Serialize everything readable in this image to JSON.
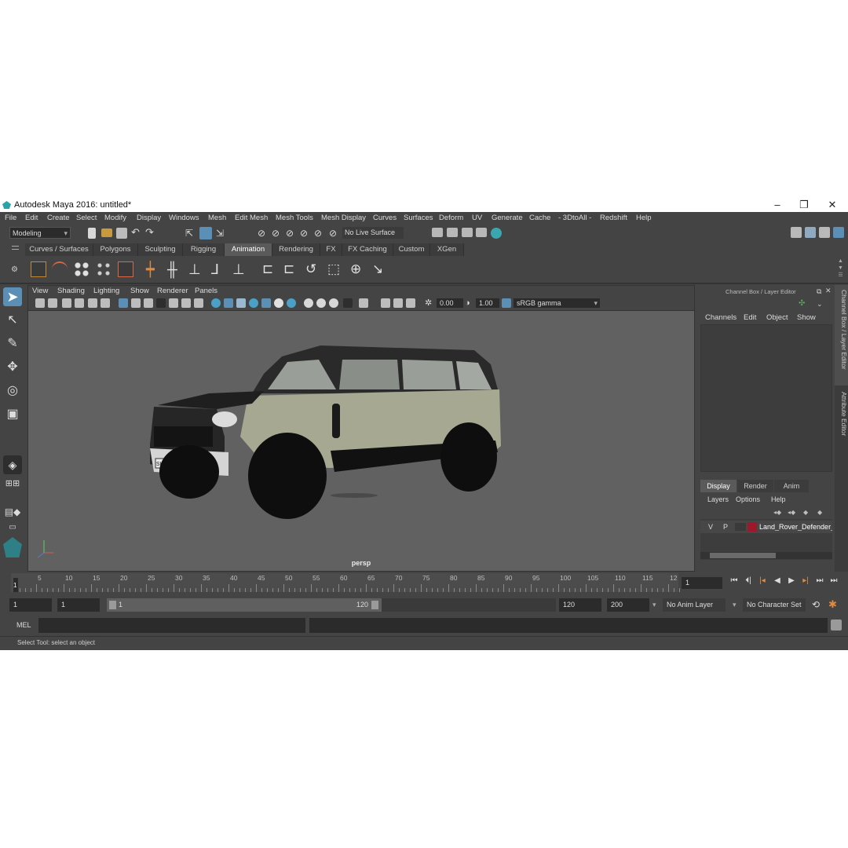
{
  "window": {
    "title": "Autodesk Maya 2016: untitled*",
    "minimize_glyph": "–",
    "restore_glyph": "❐",
    "close_glyph": "✕"
  },
  "menubar": [
    "File",
    "Edit",
    "Create",
    "Select",
    "Modify",
    "Display",
    "Windows",
    "Mesh",
    "Edit Mesh",
    "Mesh Tools",
    "Mesh Display",
    "Curves",
    "Surfaces",
    "Deform",
    "UV",
    "Generate",
    "Cache",
    "- 3DtoAll -",
    "Redshift",
    "Help"
  ],
  "status_line": {
    "menu_set": "Modeling",
    "live_surface": "No Live Surface"
  },
  "shelf_tabs": [
    {
      "label": "Curves / Surfaces",
      "active": false
    },
    {
      "label": "Polygons",
      "active": false
    },
    {
      "label": "Sculpting",
      "active": false
    },
    {
      "label": "Rigging",
      "active": false
    },
    {
      "label": "Animation",
      "active": true
    },
    {
      "label": "Rendering",
      "active": false
    },
    {
      "label": "FX",
      "active": false
    },
    {
      "label": "FX Caching",
      "active": false
    },
    {
      "label": "Custom",
      "active": false
    },
    {
      "label": "XGen",
      "active": false
    }
  ],
  "panel_menu": [
    "View",
    "Shading",
    "Lighting",
    "Show",
    "Renderer",
    "Panels"
  ],
  "panel_toolbar": {
    "near_value": "0.00",
    "gamma_value": "1.00",
    "color_space": "sRGB gamma"
  },
  "viewport": {
    "camera": "persp",
    "plate_text": "SH MD 666"
  },
  "channel_box": {
    "header": "Channel Box / Layer Editor",
    "menu": [
      "Channels",
      "Edit",
      "Object",
      "Show"
    ]
  },
  "layer_editor": {
    "tabs": [
      {
        "label": "Display",
        "active": true
      },
      {
        "label": "Render",
        "active": false
      },
      {
        "label": "Anim",
        "active": false
      }
    ],
    "menu": [
      "Layers",
      "Options",
      "Help"
    ],
    "layer": {
      "visible": "V",
      "playback": "P",
      "color": "#9a1a2b",
      "name": "Land_Rover_Defender_"
    }
  },
  "side_tabs": [
    "Channel Box / Layer Editor",
    "Attribute Editor"
  ],
  "timeline": {
    "ticks": [
      "1",
      "5",
      "10",
      "15",
      "20",
      "25",
      "30",
      "35",
      "40",
      "45",
      "50",
      "55",
      "60",
      "65",
      "70",
      "75",
      "80",
      "85",
      "90",
      "95",
      "100",
      "105",
      "110",
      "115",
      "12"
    ],
    "current_frame": "1",
    "current_marker": "1"
  },
  "playback_buttons": [
    "⏮",
    "⏴|",
    "|◂",
    "◀",
    "▶",
    "▸|",
    "⏭",
    "⏭"
  ],
  "range": {
    "start": "1",
    "playback_start": "1",
    "slider_start": "1",
    "slider_end": "120",
    "playback_end": "120",
    "end": "200",
    "anim_layer": "No Anim Layer",
    "character_set": "No Character Set"
  },
  "command_line": {
    "label": "MEL"
  },
  "help_line": {
    "text": "Select Tool: select an object"
  },
  "colors": {
    "ui_bg": "#444444",
    "viewport_bg": "#616161",
    "active_tab": "#5a5a5a",
    "layer_color": "#9a1a2b"
  }
}
